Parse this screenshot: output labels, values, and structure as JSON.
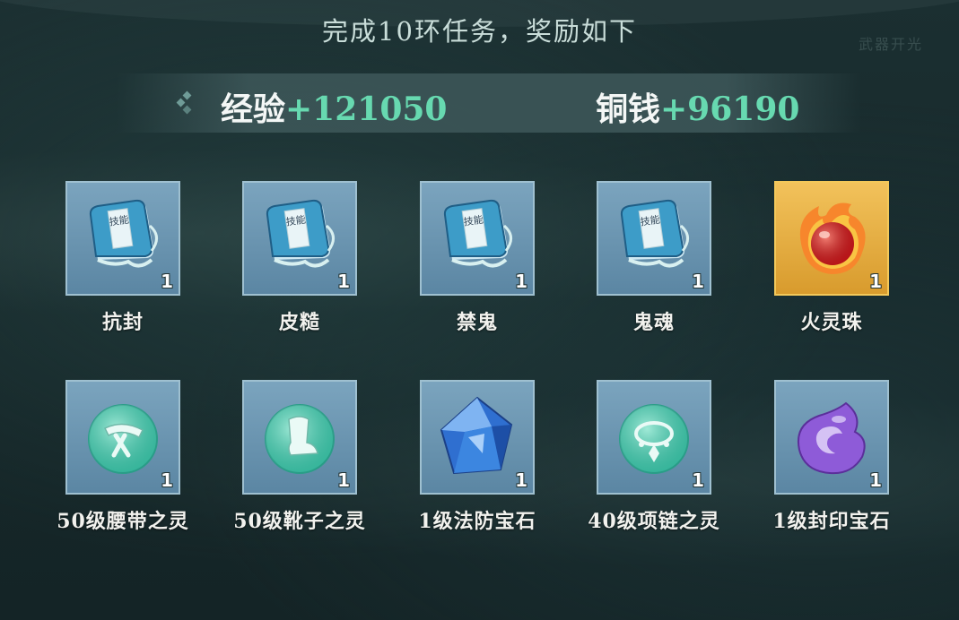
{
  "header": {
    "title": "完成10环任务，奖励如下",
    "watermark": "武器开光"
  },
  "rewards": {
    "exp_label": "经验",
    "exp_value": "+121050",
    "coin_label": "铜钱",
    "coin_value": "+96190"
  },
  "items": [
    {
      "name": "抗封",
      "count": "1",
      "icon": "skill-book-icon",
      "bg": "blue",
      "book_label": "技能"
    },
    {
      "name": "皮糙",
      "count": "1",
      "icon": "skill-book-icon",
      "bg": "blue",
      "book_label": "技能"
    },
    {
      "name": "禁鬼",
      "count": "1",
      "icon": "skill-book-icon",
      "bg": "blue",
      "book_label": "技能"
    },
    {
      "name": "鬼魂",
      "count": "1",
      "icon": "skill-book-icon",
      "bg": "blue",
      "book_label": "技能"
    },
    {
      "name": "火灵珠",
      "count": "1",
      "icon": "fire-orb-icon",
      "bg": "gold"
    },
    {
      "name": "50级腰带之灵",
      "count": "1",
      "icon": "belt-spirit-icon",
      "bg": "blue"
    },
    {
      "name": "50级靴子之灵",
      "count": "1",
      "icon": "boots-spirit-icon",
      "bg": "blue"
    },
    {
      "name": "1级法防宝石",
      "count": "1",
      "icon": "blue-gem-icon",
      "bg": "blue"
    },
    {
      "name": "40级项链之灵",
      "count": "1",
      "icon": "necklace-spirit-icon",
      "bg": "blue"
    },
    {
      "name": "1级封印宝石",
      "count": "1",
      "icon": "purple-seal-gem-icon",
      "bg": "blue"
    }
  ],
  "colors": {
    "accent_value": "#67d9b0",
    "slot_blue": "#6b95b1",
    "slot_gold": "#e6b145"
  }
}
